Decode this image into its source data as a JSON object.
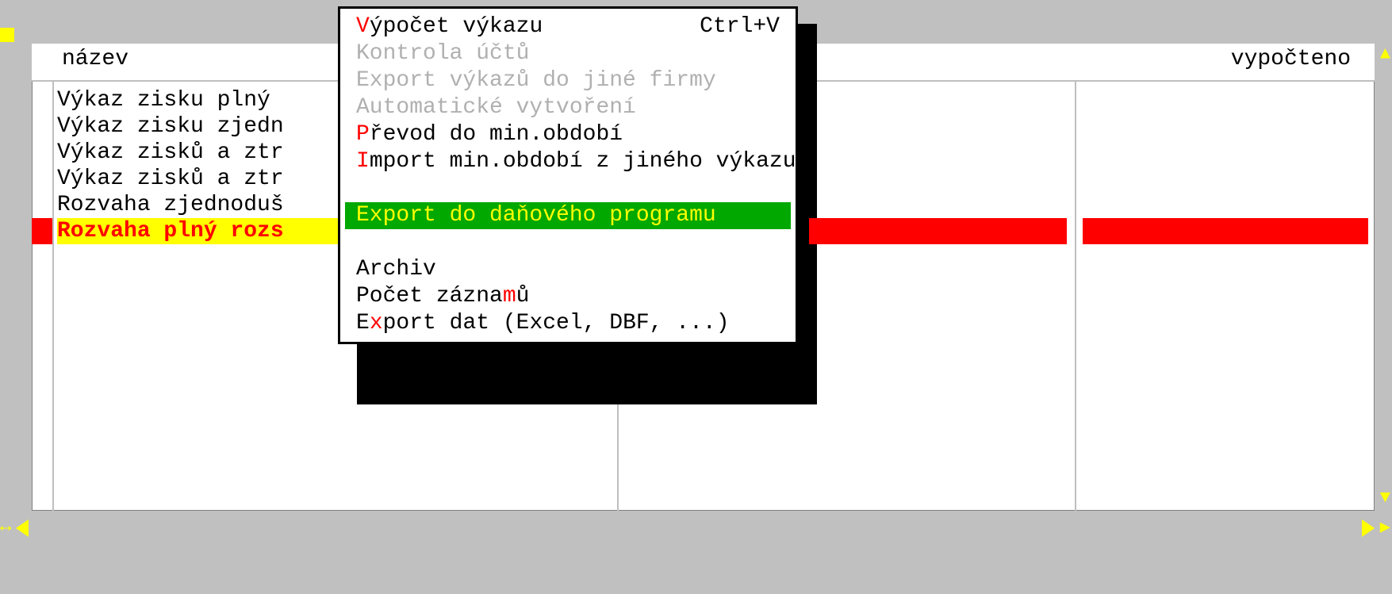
{
  "headers": {
    "name": "název",
    "calculated": "vypočteno"
  },
  "list": {
    "rows": [
      "Výkaz zisku plný",
      "Výkaz zisku zjedn",
      "Výkaz zisků a ztr",
      "Výkaz zisků a ztr",
      "Rozvaha zjednoduš",
      "Rozvaha plný rozs"
    ],
    "selected_index": 5
  },
  "menu": {
    "items": [
      {
        "hk": "V",
        "rest": "ýpočet výkazu",
        "shortcut": "Ctrl+V",
        "type": "hotkey"
      },
      {
        "text": "Kontrola účtů",
        "type": "disabled"
      },
      {
        "text": "Export výkazů do jiné firmy",
        "type": "disabled"
      },
      {
        "text": "Automatické vytvoření",
        "type": "disabled"
      },
      {
        "hk": "P",
        "rest": "řevod do min.období",
        "type": "hotkey"
      },
      {
        "hk": "I",
        "rest": "mport min.období z jiného výkazu",
        "type": "hotkey"
      },
      {
        "type": "spacer"
      },
      {
        "text": "Export do daňového programu",
        "type": "highlight"
      },
      {
        "type": "spacer"
      },
      {
        "text": "Archiv",
        "type": "plain"
      },
      {
        "pre": "Počet zázna",
        "hk": "m",
        "rest": "ů",
        "type": "hotkey-mid"
      },
      {
        "pre": "E",
        "hk": "x",
        "rest": "port dat (Excel, DBF, ...)",
        "type": "hotkey-mid"
      }
    ]
  }
}
